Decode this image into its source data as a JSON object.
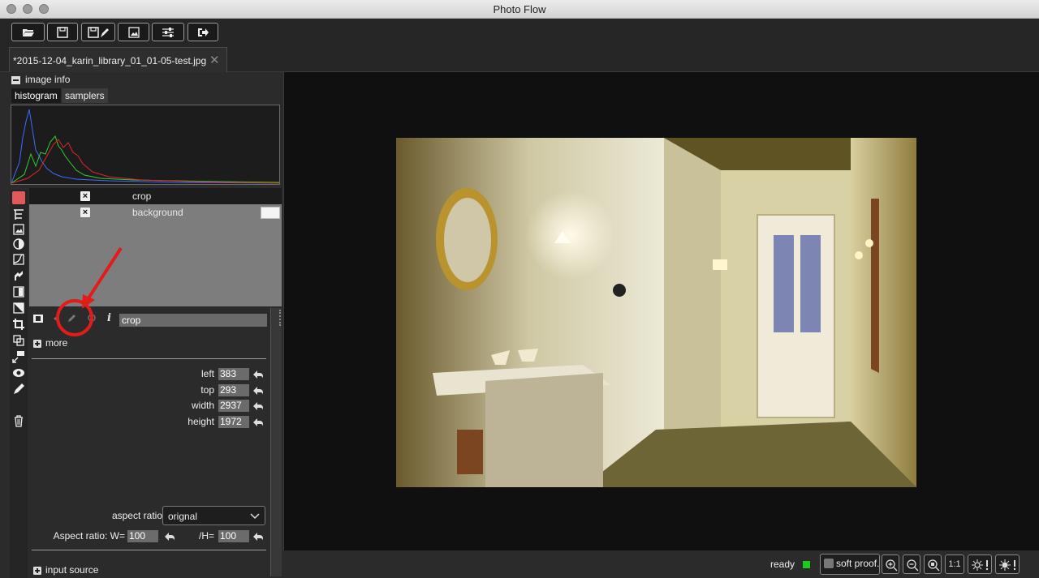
{
  "window": {
    "title": "Photo Flow"
  },
  "toolbar": {
    "buttons": [
      {
        "name": "open-file-button",
        "icon": "folder-icon"
      },
      {
        "name": "save-button",
        "icon": "save-icon"
      },
      {
        "name": "save-as-button",
        "icon": "save-as-icon"
      },
      {
        "name": "export-button",
        "icon": "export-image-icon"
      },
      {
        "name": "settings-button",
        "icon": "sliders-icon"
      },
      {
        "name": "exit-button",
        "icon": "exit-icon"
      }
    ]
  },
  "tabs": [
    {
      "label": "*2015-12-04_karin_library_01_01-05-test.jpg",
      "close": "✕"
    }
  ],
  "image_info": {
    "label": "image info",
    "tabs": [
      "histogram",
      "samplers"
    ]
  },
  "layers": [
    {
      "name": "crop",
      "selected": true
    },
    {
      "name": "background",
      "selected": false
    }
  ],
  "tool_icons": [
    "layers-icon",
    "tree-icon",
    "image-icon",
    "contrast-icon",
    "curves-icon",
    "path-icon",
    "gradient-icon",
    "mask-icon",
    "crop-icon",
    "transform-icon",
    "scale-icon",
    "eye-icon",
    "brush-icon",
    "trash-icon"
  ],
  "layer_props": {
    "name_value": "crop",
    "info_glyph": "i",
    "more_label": "more",
    "fields": [
      {
        "label": "left",
        "value": "383"
      },
      {
        "label": "top",
        "value": "293"
      },
      {
        "label": "width",
        "value": "2937"
      },
      {
        "label": "height",
        "value": "1972"
      }
    ],
    "aspect_ratio_label": "aspect ratio",
    "aspect_ratio_value": "orignal",
    "aspect_w_label": "Aspect ratio: W=",
    "aspect_w_value": "100",
    "aspect_h_label": "/H=",
    "aspect_h_value": "100",
    "input_source_label": "input source"
  },
  "status": {
    "text": "ready",
    "led_color": "#1ec81e",
    "soft_proof_label": "soft proof.",
    "zoom_one_label": "1:1"
  },
  "annotation": {
    "color": "#e21b1b"
  }
}
